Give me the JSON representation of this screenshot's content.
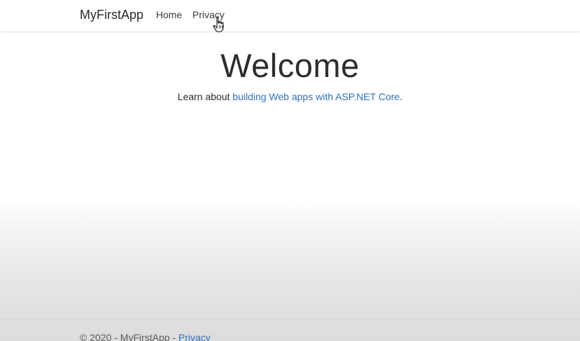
{
  "navbar": {
    "brand": "MyFirstApp",
    "links": [
      {
        "label": "Home"
      },
      {
        "label": "Privacy"
      }
    ]
  },
  "main": {
    "title": "Welcome",
    "lead_prefix": "Learn about ",
    "lead_link": "building Web apps with ASP.NET Core",
    "lead_suffix": "."
  },
  "footer": {
    "copyright": "© 2020 - MyFirstApp - ",
    "privacy_link": "Privacy"
  },
  "colors": {
    "link": "#2f6fbf",
    "text": "#2b2b2b"
  },
  "cursor": {
    "icon": "hand-pointer-icon"
  }
}
